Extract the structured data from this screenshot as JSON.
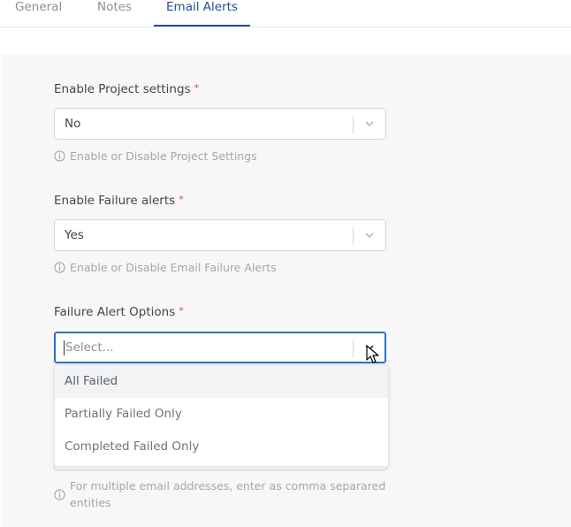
{
  "tabs": [
    {
      "label": "General",
      "active": false
    },
    {
      "label": "Notes",
      "active": false
    },
    {
      "label": "Email Alerts",
      "active": true
    }
  ],
  "fields": {
    "project_settings": {
      "label": "Enable Project settings",
      "required_mark": "*",
      "value": "No",
      "help": "Enable or Disable Project Settings"
    },
    "failure_alerts": {
      "label": "Enable Failure alerts",
      "required_mark": "*",
      "value": "Yes",
      "help": "Enable or Disable Email Failure Alerts"
    },
    "failure_alert_options": {
      "label": "Failure Alert Options",
      "required_mark": "*",
      "placeholder": "Select...",
      "options": [
        "All Failed",
        "Partially Failed Only",
        "Completed Failed Only"
      ],
      "highlighted_option": "All Failed"
    }
  },
  "email_help": "For multiple email addresses, enter as comma separared entities",
  "colors": {
    "accent": "#1d4f91",
    "focus": "#2e6fc9",
    "required": "#e2453c",
    "panel_bg": "#f7f7f7"
  },
  "icons": [
    "chevron-down-icon",
    "info-icon",
    "mouse-pointer-icon"
  ]
}
